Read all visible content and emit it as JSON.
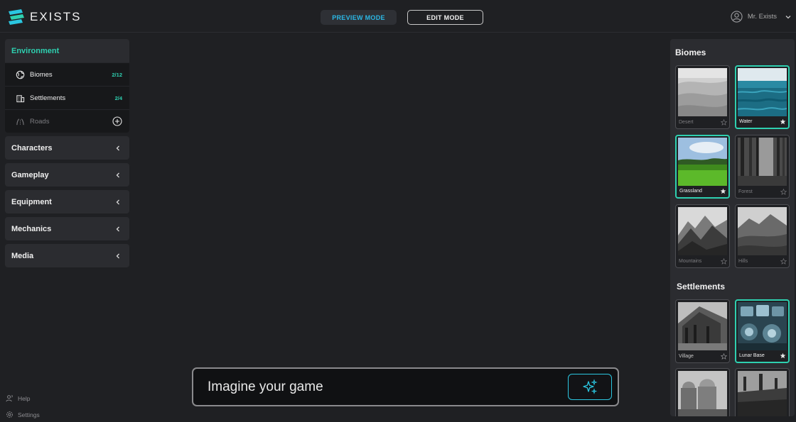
{
  "app": {
    "brand": "EXISTS"
  },
  "modes": {
    "preview_label": "PREVIEW MODE",
    "edit_label": "EDIT MODE"
  },
  "user": {
    "name": "Mr. Exists"
  },
  "sidebar": {
    "environment": {
      "label": "Environment",
      "items": [
        {
          "label": "Biomes",
          "count": "2/12"
        },
        {
          "label": "Settlements",
          "count": "2/4"
        },
        {
          "label": "Roads",
          "count": ""
        }
      ]
    },
    "categories": [
      {
        "label": "Characters"
      },
      {
        "label": "Gameplay"
      },
      {
        "label": "Equipment"
      },
      {
        "label": "Mechanics"
      },
      {
        "label": "Media"
      }
    ]
  },
  "footer_links": {
    "help": "Help",
    "settings": "Settings"
  },
  "prompt": {
    "placeholder": "Imagine your game"
  },
  "panel": {
    "biomes_title": "Biomes",
    "biomes": [
      {
        "label": "Desert",
        "selected": false
      },
      {
        "label": "Water",
        "selected": true
      },
      {
        "label": "Grassland",
        "selected": true
      },
      {
        "label": "Forest",
        "selected": false
      },
      {
        "label": "Mountains",
        "selected": false
      },
      {
        "label": "Hills",
        "selected": false
      }
    ],
    "settlements_title": "Settlements",
    "settlements": [
      {
        "label": "Village",
        "selected": false
      },
      {
        "label": "Lunar Base",
        "selected": true
      }
    ]
  },
  "colors": {
    "accent": "#2ed0b0",
    "preview_accent": "#2bb8e6",
    "background": "#1f2023"
  }
}
